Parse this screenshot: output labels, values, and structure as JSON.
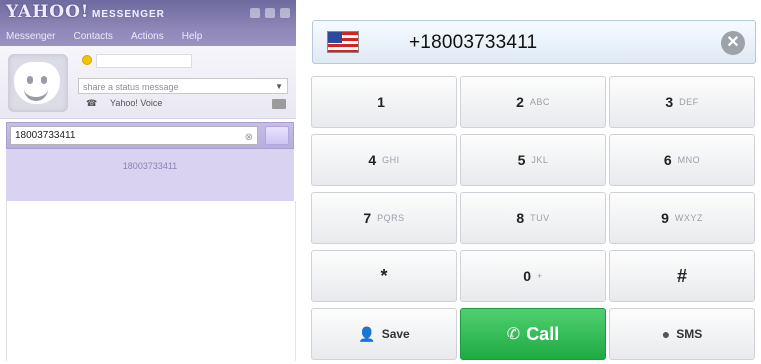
{
  "messenger": {
    "logo": "YAHOO!",
    "subtitle": "MESSENGER",
    "menu": [
      "Messenger",
      "Contacts",
      "Actions",
      "Help"
    ],
    "status_placeholder": "share a status message",
    "voice_label": "Yahoo! Voice",
    "search_value": "18003733411",
    "search_result": "18003733411"
  },
  "dialer": {
    "number": "+18003733411",
    "clear_icon": "clear-x-icon",
    "flag_icon": "us-flag-icon",
    "keys": [
      {
        "digit": "1",
        "letters": ""
      },
      {
        "digit": "2",
        "letters": "ABC"
      },
      {
        "digit": "3",
        "letters": "DEF"
      },
      {
        "digit": "4",
        "letters": "GHI"
      },
      {
        "digit": "5",
        "letters": "JKL"
      },
      {
        "digit": "6",
        "letters": "MNO"
      },
      {
        "digit": "7",
        "letters": "PQRS"
      },
      {
        "digit": "8",
        "letters": "TUV"
      },
      {
        "digit": "9",
        "letters": "WXYZ"
      },
      {
        "digit": "*",
        "letters": ""
      },
      {
        "digit": "0",
        "letters": "+"
      },
      {
        "digit": "#",
        "letters": ""
      }
    ],
    "actions": {
      "save": "Save",
      "call": "Call",
      "sms": "SMS"
    },
    "colors": {
      "call_button": "#2bb24c",
      "key_border": "#cfd3d8"
    }
  }
}
